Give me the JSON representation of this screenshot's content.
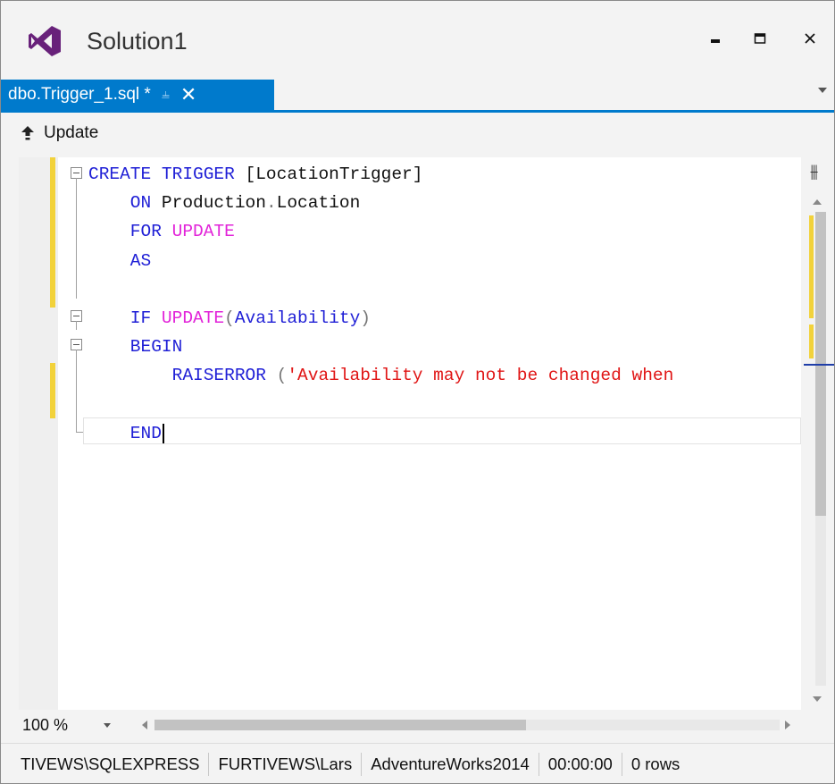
{
  "window": {
    "title": "Solution1",
    "icons": {
      "logo": "visual-studio-logo",
      "minimize": "minimize-icon",
      "maximize": "maximize-icon",
      "close": "close-icon"
    }
  },
  "tab": {
    "label": "dbo.Trigger_1.sql *",
    "pin_icon": "pin-icon",
    "close_icon": "close-icon",
    "active_color": "#007acc"
  },
  "toolbar": {
    "update_label": "Update",
    "update_icon": "arrow-up-icon"
  },
  "editor": {
    "lines": [
      {
        "parts": [
          {
            "t": "CREATE TRIGGER ",
            "c": "kw"
          },
          {
            "t": "[LocationTrigger]",
            "c": "txt"
          }
        ]
      },
      {
        "parts": [
          {
            "t": "    ON ",
            "c": "kw"
          },
          {
            "t": "Production",
            "c": "txt"
          },
          {
            "t": ".",
            "c": "punc"
          },
          {
            "t": "Location",
            "c": "txt"
          }
        ]
      },
      {
        "parts": [
          {
            "t": "    FOR ",
            "c": "kw"
          },
          {
            "t": "UPDATE",
            "c": "fn"
          }
        ]
      },
      {
        "parts": [
          {
            "t": "    AS",
            "c": "kw"
          }
        ]
      },
      {
        "parts": []
      },
      {
        "parts": [
          {
            "t": "    IF ",
            "c": "kw"
          },
          {
            "t": "UPDATE",
            "c": "fn"
          },
          {
            "t": "(",
            "c": "punc"
          },
          {
            "t": "Availability",
            "c": "kw"
          },
          {
            "t": ")",
            "c": "punc"
          }
        ]
      },
      {
        "parts": [
          {
            "t": "    BEGIN",
            "c": "kw"
          }
        ]
      },
      {
        "parts": [
          {
            "t": "        RAISERROR ",
            "c": "kw"
          },
          {
            "t": "(",
            "c": "punc"
          },
          {
            "t": "'Availability may not be changed when",
            "c": "str"
          }
        ]
      },
      {
        "parts": []
      },
      {
        "parts": [
          {
            "t": "    END",
            "c": "kw"
          }
        ]
      }
    ],
    "colors": {
      "keyword": "#1f1fd6",
      "function": "#e224d9",
      "string": "#e01515",
      "change_marker": "#f2d23b"
    }
  },
  "bottom": {
    "zoom": "100 %",
    "scroll_left_icon": "arrow-left-icon",
    "scroll_right_icon": "arrow-right-icon"
  },
  "status": {
    "server": "TIVEWS\\SQLEXPRESS",
    "user": "FURTIVEWS\\Lars",
    "database": "AdventureWorks2014",
    "elapsed": "00:00:00",
    "rows": "0 rows"
  }
}
